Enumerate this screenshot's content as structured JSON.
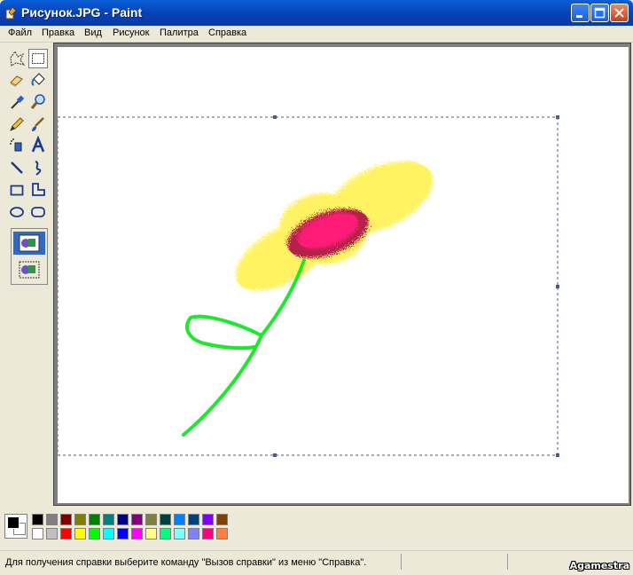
{
  "window": {
    "title": "Рисунок.JPG - Paint"
  },
  "menu": [
    "Файл",
    "Правка",
    "Вид",
    "Рисунок",
    "Палитра",
    "Справка"
  ],
  "tools": [
    {
      "name": "free-select-icon",
      "selected": false
    },
    {
      "name": "rect-select-icon",
      "selected": true
    },
    {
      "name": "eraser-icon",
      "selected": false
    },
    {
      "name": "fill-bucket-icon",
      "selected": false
    },
    {
      "name": "pick-color-icon",
      "selected": false
    },
    {
      "name": "magnifier-icon",
      "selected": false
    },
    {
      "name": "pencil-icon",
      "selected": false
    },
    {
      "name": "brush-icon",
      "selected": false
    },
    {
      "name": "airbrush-icon",
      "selected": false
    },
    {
      "name": "text-icon",
      "selected": false
    },
    {
      "name": "line-icon",
      "selected": false
    },
    {
      "name": "curve-icon",
      "selected": false
    },
    {
      "name": "rectangle-icon",
      "selected": false
    },
    {
      "name": "polygon-icon",
      "selected": false
    },
    {
      "name": "ellipse-icon",
      "selected": false
    },
    {
      "name": "rounded-rect-icon",
      "selected": false
    }
  ],
  "palette": {
    "foreground": "#000000",
    "background": "#ffffff",
    "row1": [
      "#000000",
      "#808080",
      "#800000",
      "#808000",
      "#008000",
      "#008080",
      "#000080",
      "#800080",
      "#808040",
      "#004040",
      "#0080ff",
      "#004080",
      "#8000ff",
      "#804000"
    ],
    "row2": [
      "#ffffff",
      "#c0c0c0",
      "#ff0000",
      "#ffff00",
      "#00ff00",
      "#00ffff",
      "#0000ff",
      "#ff00ff",
      "#ffff80",
      "#00ff80",
      "#80ffff",
      "#8080ff",
      "#ff0080",
      "#ff8040"
    ]
  },
  "status": {
    "help_text": "Для получения справки выберите команду \"Вызов справки\" из меню \"Справка\".",
    "watermark": "Agamestra"
  }
}
